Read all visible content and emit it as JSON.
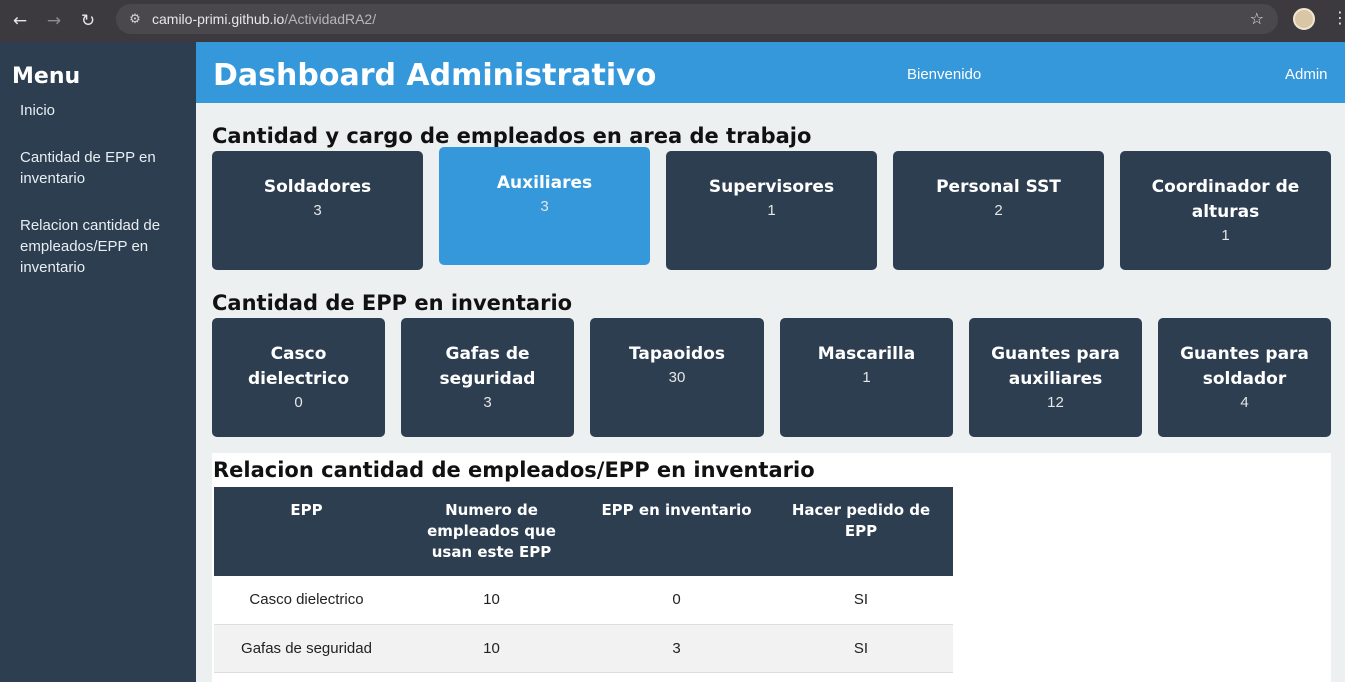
{
  "browser": {
    "url_host": "camilo-primi.github.io",
    "url_path": "/ActividadRA2/"
  },
  "sidebar": {
    "title": "Menu",
    "items": [
      {
        "label": "Inicio"
      },
      {
        "label": "Cantidad de EPP en inventario"
      },
      {
        "label": "Relacion cantidad de empleados/EPP en inventario"
      }
    ]
  },
  "header": {
    "title": "Dashboard Administrativo",
    "welcome": "Bienvenido",
    "user": "Admin"
  },
  "employees_section": {
    "title": "Cantidad y cargo de empleados en area de trabajo",
    "cards": [
      {
        "label": "Soldadores",
        "value": "3"
      },
      {
        "label": "Auxiliares",
        "value": "3"
      },
      {
        "label": "Supervisores",
        "value": "1"
      },
      {
        "label": "Personal SST",
        "value": "2"
      },
      {
        "label": "Coordinador de alturas",
        "value": "1"
      }
    ]
  },
  "epp_section": {
    "title": "Cantidad de EPP en inventario",
    "cards": [
      {
        "label": "Casco dielectrico",
        "value": "0"
      },
      {
        "label": "Gafas de seguridad",
        "value": "3"
      },
      {
        "label": "Tapaoidos",
        "value": "30"
      },
      {
        "label": "Mascarilla",
        "value": "1"
      },
      {
        "label": "Guantes para auxiliares",
        "value": "12"
      },
      {
        "label": "Guantes para soldador",
        "value": "4"
      }
    ]
  },
  "relation_section": {
    "title": "Relacion cantidad de empleados/EPP en inventario",
    "headers": [
      "EPP",
      "Numero de empleados que usan este EPP",
      "EPP en inventario",
      "Hacer pedido de EPP"
    ],
    "rows": [
      [
        "Casco dielectrico",
        "10",
        "0",
        "SI"
      ],
      [
        "Gafas de seguridad",
        "10",
        "3",
        "SI"
      ]
    ]
  },
  "colors": {
    "sidebar": "#2c3e50",
    "header": "#3498db",
    "card": "#2c3e50",
    "card_active": "#3498db",
    "background": "#ecf0f1"
  }
}
